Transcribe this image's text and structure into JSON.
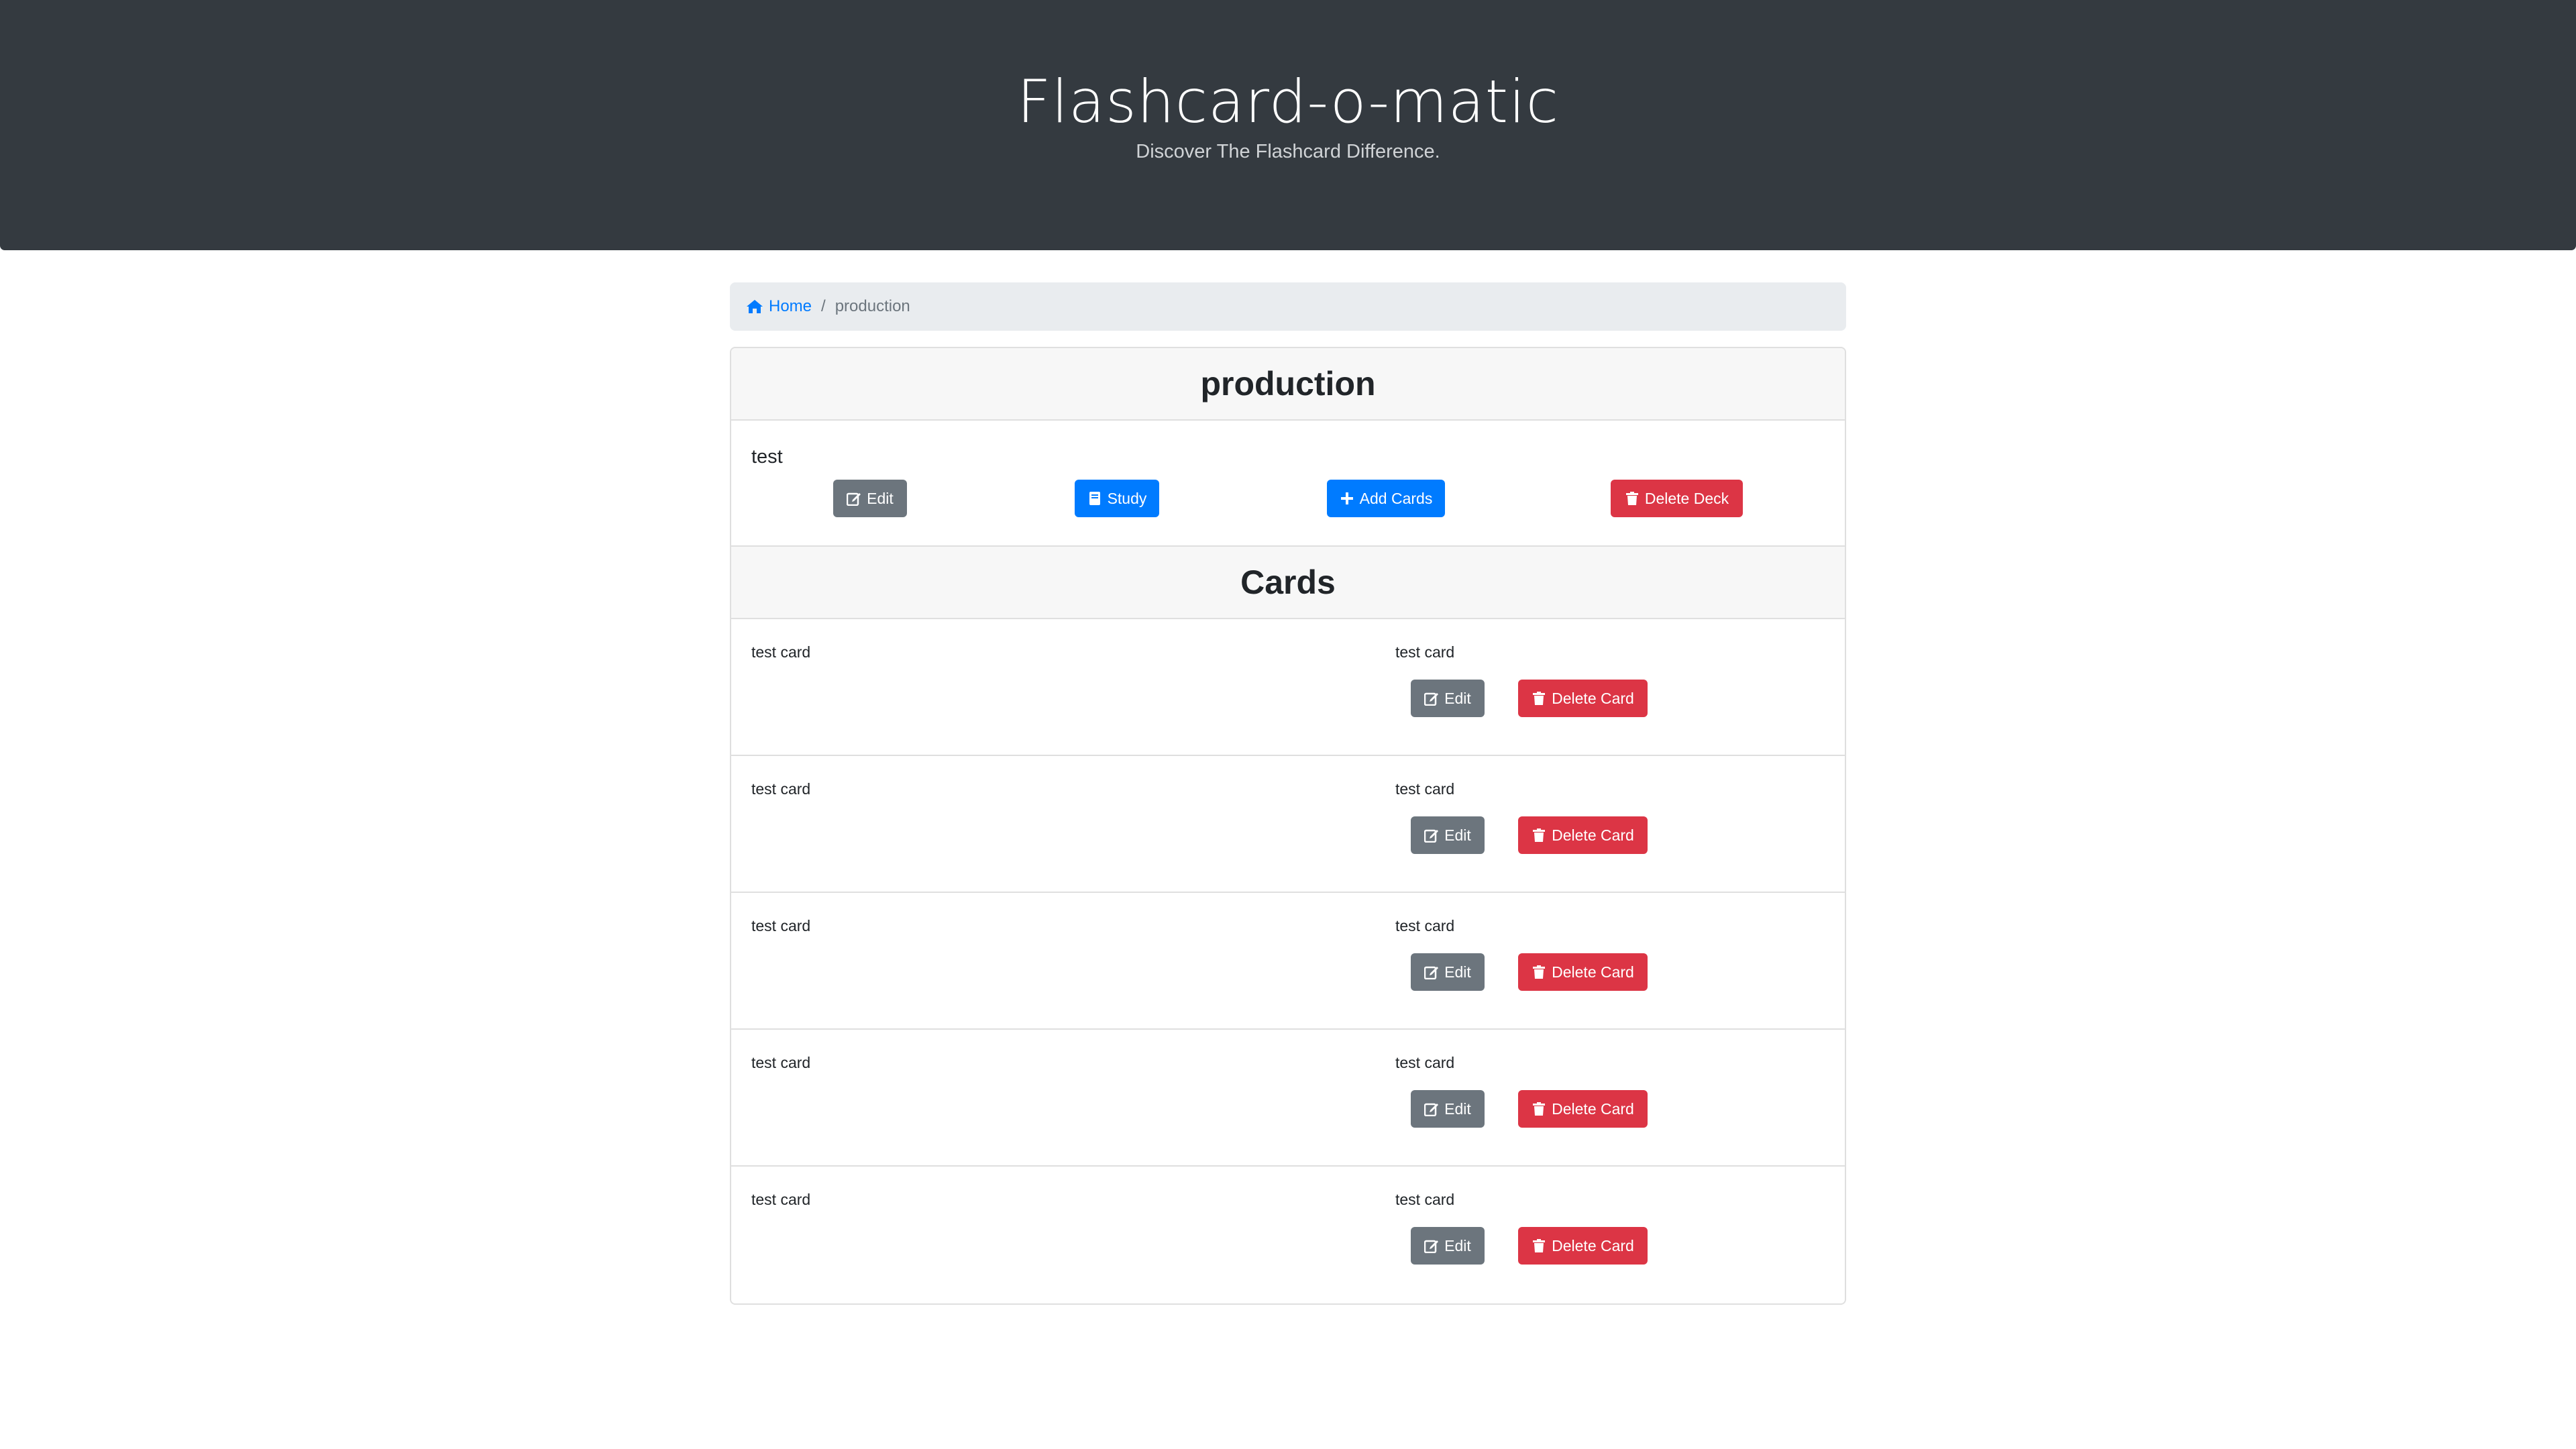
{
  "header": {
    "title": "Flashcard-o-matic",
    "subtitle": "Discover The Flashcard Difference."
  },
  "breadcrumb": {
    "home": "Home",
    "separator": "/",
    "current": "production"
  },
  "deck": {
    "name": "production",
    "description": "test",
    "buttons": {
      "edit": "Edit",
      "study": "Study",
      "add_cards": "Add Cards",
      "delete_deck": "Delete Deck"
    }
  },
  "cards_section": {
    "title": "Cards",
    "edit_label": "Edit",
    "delete_label": "Delete Card",
    "items": [
      {
        "front": "test card",
        "back": "test card"
      },
      {
        "front": "test card",
        "back": "test card"
      },
      {
        "front": "test card",
        "back": "test card"
      },
      {
        "front": "test card",
        "back": "test card"
      },
      {
        "front": "test card",
        "back": "test card"
      }
    ]
  },
  "colors": {
    "header_bg": "#343a40",
    "primary": "#007bff",
    "secondary": "#6c757d",
    "danger": "#dc3545"
  },
  "icons": {
    "home": "home-icon",
    "edit": "edit-icon",
    "study": "book-icon",
    "add": "plus-icon",
    "delete": "trash-icon"
  }
}
